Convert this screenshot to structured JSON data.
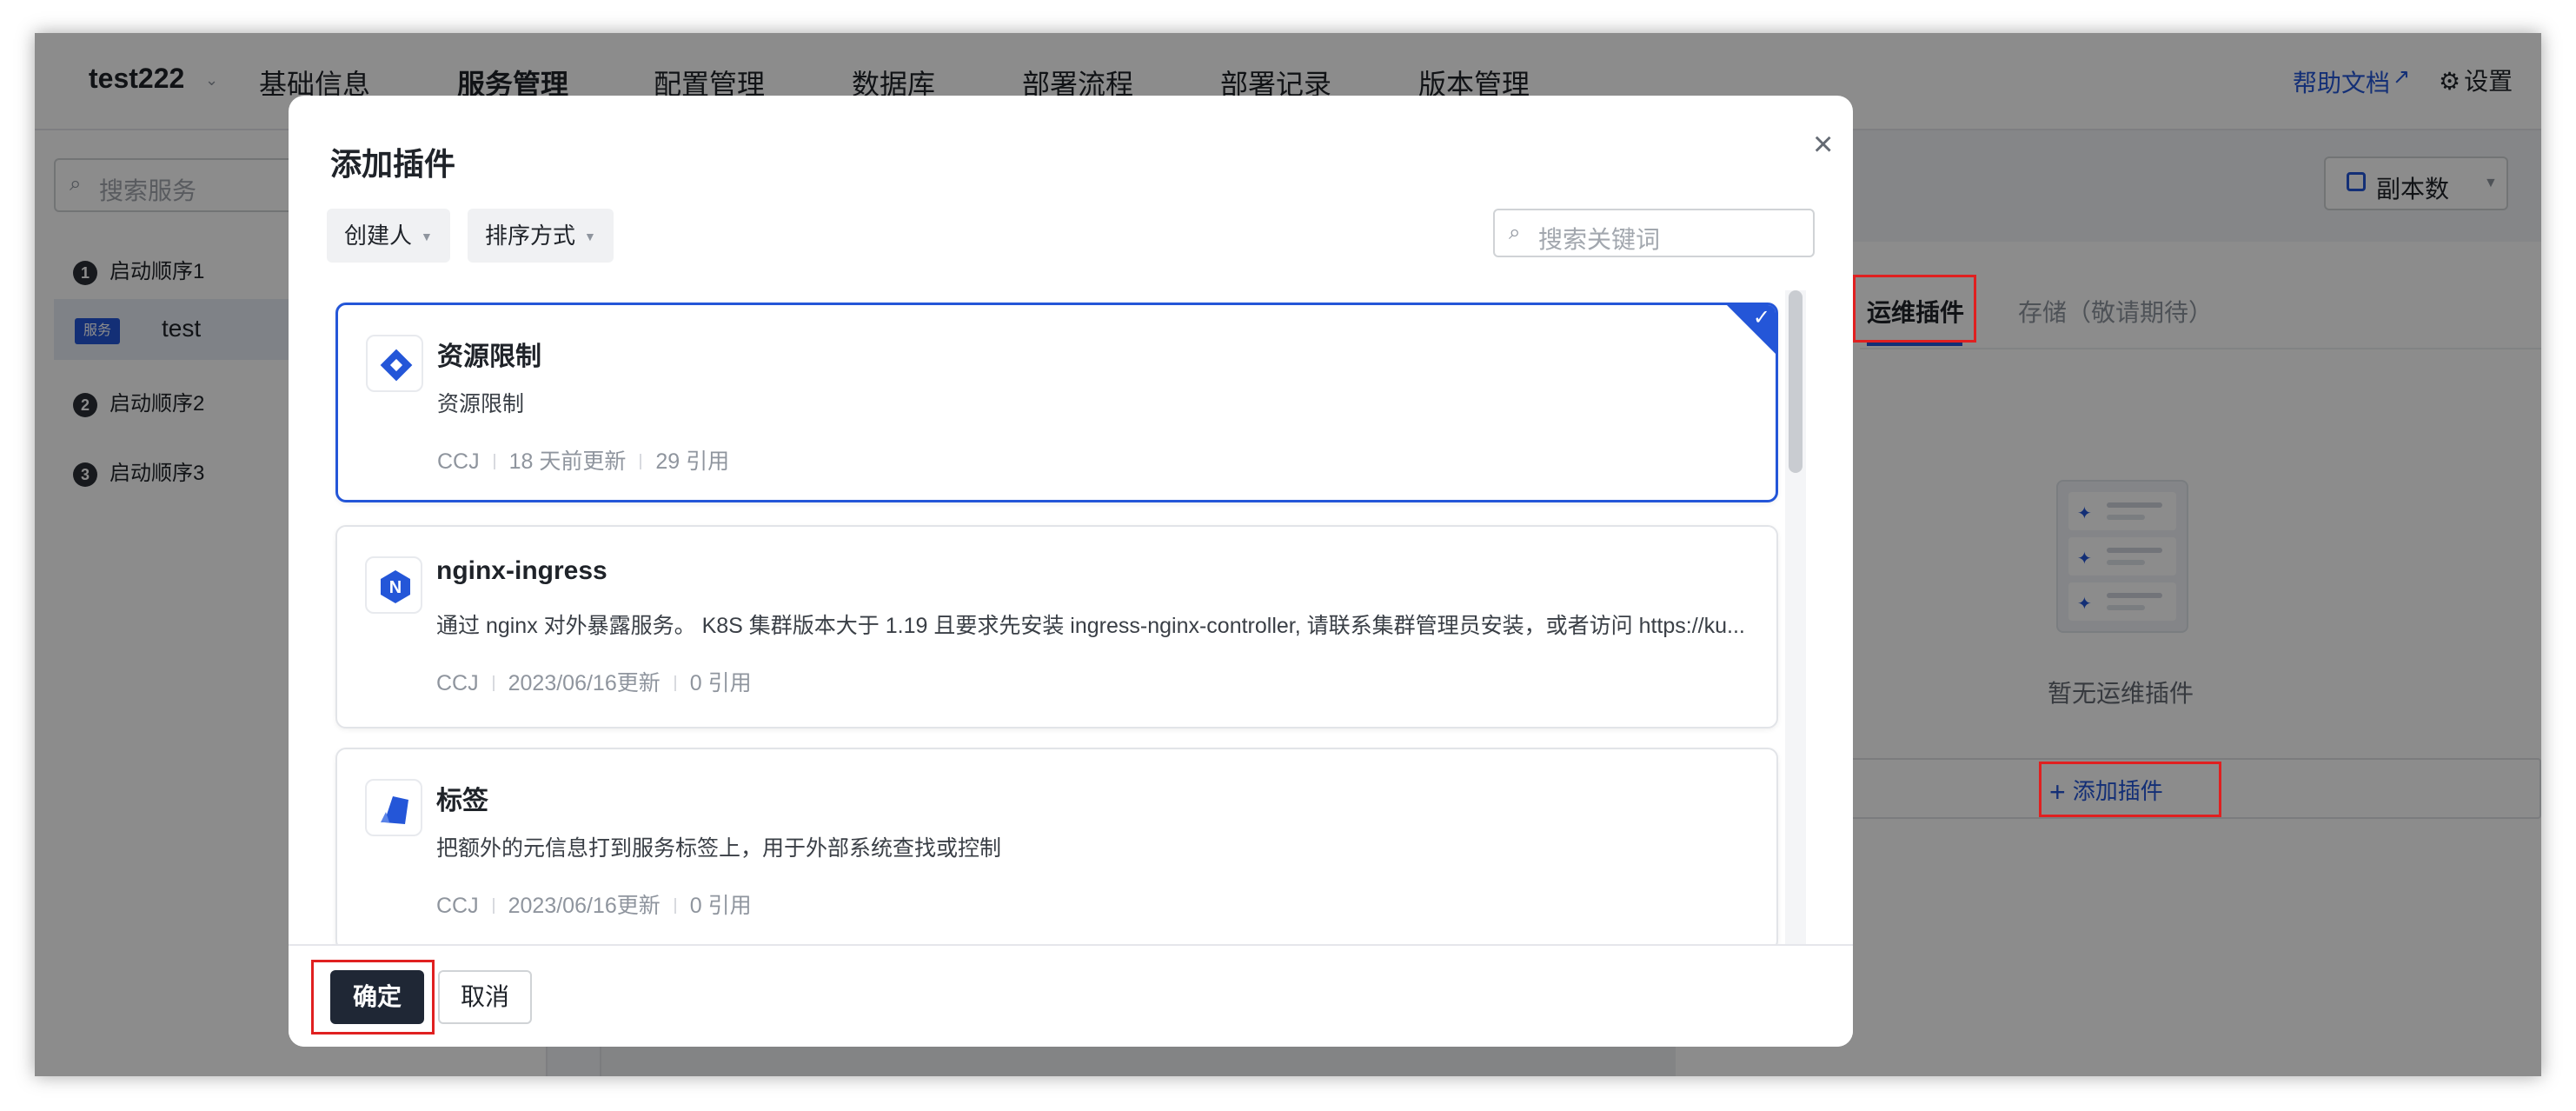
{
  "header": {
    "app_name": "test222",
    "nav": [
      "基础信息",
      "服务管理",
      "配置管理",
      "数据库",
      "部署流程",
      "部署记录",
      "版本管理"
    ],
    "active_nav": "服务管理",
    "help_label": "帮助文档",
    "settings_label": "设置"
  },
  "sidebar": {
    "search_placeholder": "搜索服务",
    "steps": [
      {
        "num": "1",
        "label": "启动顺序1"
      },
      {
        "num": "2",
        "label": "启动顺序2"
      },
      {
        "num": "3",
        "label": "启动顺序3"
      }
    ],
    "service": {
      "tag": "服务",
      "name": "test"
    }
  },
  "right_panel": {
    "replica_label": "副本数",
    "tabs": [
      "运维插件",
      "存储（敬请期待）"
    ],
    "active_tab": "运维插件",
    "empty_text": "暂无运维插件",
    "add_plugin_label": "添加插件"
  },
  "modal": {
    "title": "添加插件",
    "filters": [
      "创建人",
      "排序方式"
    ],
    "search_placeholder": "搜索关键词",
    "plugins": [
      {
        "name": "资源限制",
        "description": "资源限制",
        "author": "CCJ",
        "updated": "18 天前更新",
        "refs": "29 引用",
        "selected": true
      },
      {
        "name": "nginx-ingress",
        "description": "通过 nginx 对外暴露服务。 K8S 集群版本大于 1.19 且要求先安装 ingress-nginx-controller, 请联系集群管理员安装，或者访问 https://ku...",
        "author": "CCJ",
        "updated": "2023/06/16更新",
        "refs": "0 引用",
        "selected": false
      },
      {
        "name": "标签",
        "description": "把额外的元信息打到服务标签上，用于外部系统查找或控制",
        "author": "CCJ",
        "updated": "2023/06/16更新",
        "refs": "0 引用",
        "selected": false
      }
    ],
    "ok_label": "确定",
    "cancel_label": "取消"
  },
  "colors": {
    "accent": "#2456d8",
    "primary_button": "#1f2735",
    "highlight": "#e02020"
  }
}
